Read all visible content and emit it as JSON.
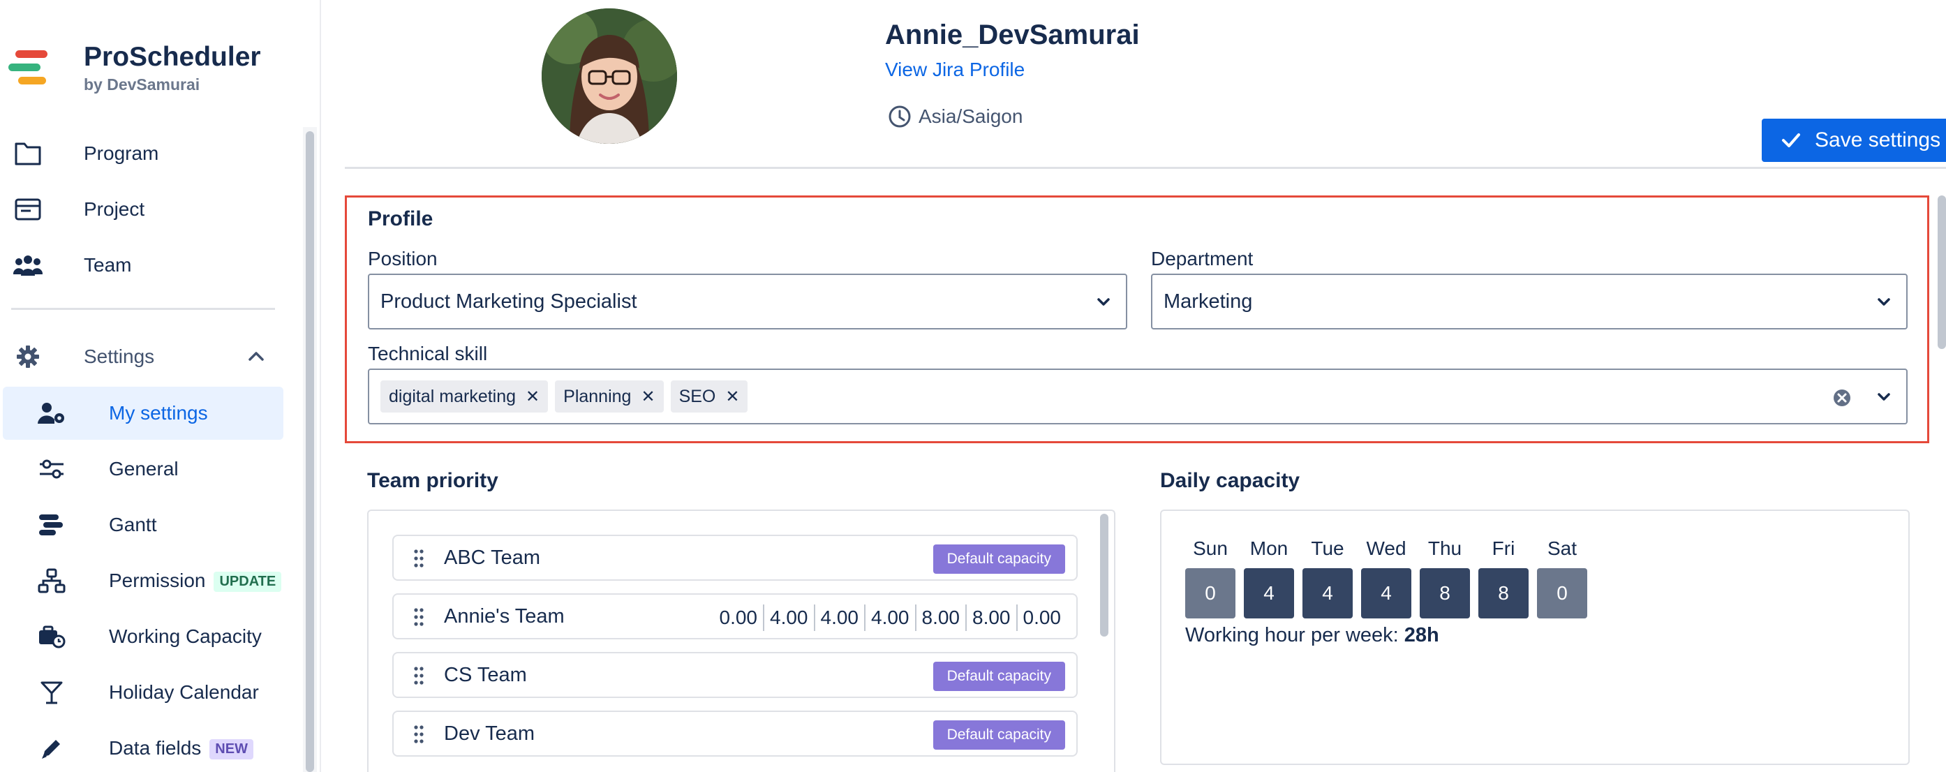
{
  "brand": {
    "title": "ProScheduler",
    "subtitle": "by DevSamurai"
  },
  "nav": {
    "program": "Program",
    "project": "Project",
    "team": "Team",
    "settings": "Settings",
    "my_settings": "My settings",
    "general": "General",
    "gantt": "Gantt",
    "permission": "Permission",
    "permission_badge": "UPDATE",
    "working_capacity": "Working Capacity",
    "holiday_calendar": "Holiday Calendar",
    "data_fields": "Data fields",
    "data_fields_badge": "NEW"
  },
  "header": {
    "user_name": "Annie_DevSamurai",
    "jira_link": "View Jira Profile",
    "timezone": "Asia/Saigon",
    "save_button": "Save settings"
  },
  "profile": {
    "title": "Profile",
    "position_label": "Position",
    "position_value": "Product Marketing Specialist",
    "department_label": "Department",
    "department_value": "Marketing",
    "skill_label": "Technical skill",
    "skills": [
      "digital marketing",
      "Planning",
      "SEO"
    ]
  },
  "team_priority": {
    "title": "Team priority",
    "default_badge": "Default capacity",
    "teams": [
      {
        "name": "ABC Team"
      },
      {
        "name": "Annie's Team",
        "capacity": [
          "0.00",
          "4.00",
          "4.00",
          "4.00",
          "8.00",
          "8.00",
          "0.00"
        ]
      },
      {
        "name": "CS Team"
      },
      {
        "name": "Dev Team"
      }
    ]
  },
  "daily_capacity": {
    "title": "Daily capacity",
    "days": [
      {
        "name": "Sun",
        "value": "0"
      },
      {
        "name": "Mon",
        "value": "4"
      },
      {
        "name": "Tue",
        "value": "4"
      },
      {
        "name": "Wed",
        "value": "4"
      },
      {
        "name": "Thu",
        "value": "8"
      },
      {
        "name": "Fri",
        "value": "8"
      },
      {
        "name": "Sat",
        "value": "0"
      }
    ],
    "week_label": "Working hour per week: ",
    "week_total": "28h"
  },
  "colors": {
    "accent": "#0c66e4",
    "highlight_border": "#e5493a",
    "badge_purple": "#8777d9",
    "day_dark": "#344563",
    "day_off": "#6b778c"
  }
}
